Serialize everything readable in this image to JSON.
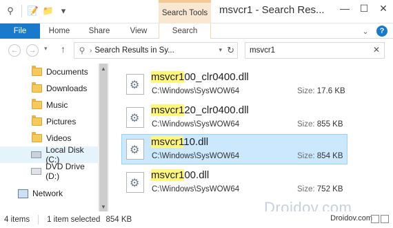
{
  "titlebar": {
    "context_tab_label": "Search Tools",
    "window_title": "msvcr1 - Search Res...",
    "minimize": "—",
    "maximize": "☐",
    "close": "✕"
  },
  "ribbon": {
    "tabs": {
      "file": "File",
      "home": "Home",
      "share": "Share",
      "view": "View",
      "search": "Search"
    },
    "help": "?"
  },
  "address": {
    "path": "Search Results in Sy...",
    "search_value": "msvcr1"
  },
  "sidebar": {
    "items": [
      {
        "label": "Documents",
        "icon": "folder-icon"
      },
      {
        "label": "Downloads",
        "icon": "folder-icon"
      },
      {
        "label": "Music",
        "icon": "folder-icon"
      },
      {
        "label": "Pictures",
        "icon": "folder-icon"
      },
      {
        "label": "Videos",
        "icon": "folder-icon"
      },
      {
        "label": "Local Disk (C:)",
        "icon": "disk-icon"
      },
      {
        "label": "DVD Drive (D:)",
        "icon": "dvd-icon"
      },
      {
        "label": "Network",
        "icon": "network-icon"
      }
    ]
  },
  "files": [
    {
      "highlight": "msvcr1",
      "rest": "00_clr0400.dll",
      "path": "C:\\Windows\\SysWOW64",
      "size_label": "Size:",
      "size": "17.6 KB"
    },
    {
      "highlight": "msvcr1",
      "rest": "20_clr0400.dll",
      "path": "C:\\Windows\\SysWOW64",
      "size_label": "Size:",
      "size": "855 KB"
    },
    {
      "highlight": "msvcr1",
      "rest": "10.dll",
      "path": "C:\\Windows\\SysWOW64",
      "size_label": "Size:",
      "size": "854 KB"
    },
    {
      "highlight": "msvcr1",
      "rest": "00.dll",
      "path": "C:\\Windows\\SysWOW64",
      "size_label": "Size:",
      "size": "752 KB"
    }
  ],
  "watermark": "Droidov.com",
  "status": {
    "items": "4 items",
    "selected": "1 item selected",
    "selected_size": "854 KB",
    "url": "Droidov.com"
  }
}
